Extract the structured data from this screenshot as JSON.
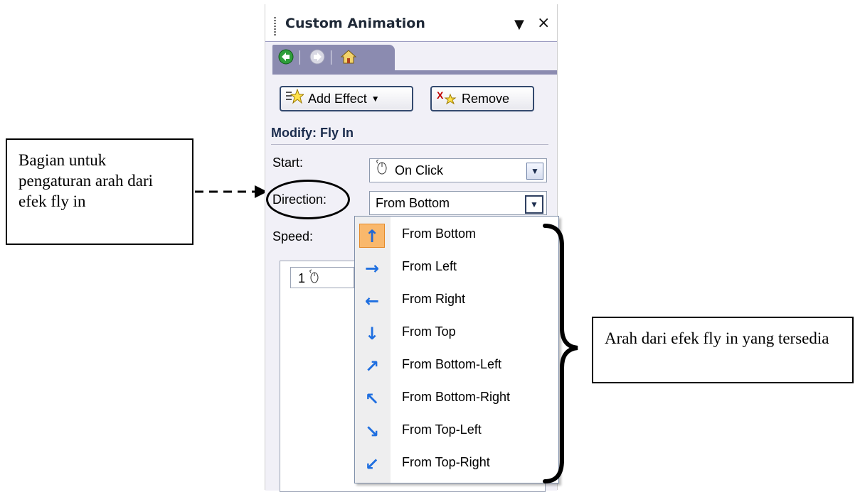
{
  "pane": {
    "title": "Custom Animation",
    "dropdown_glyph": "▼",
    "close_glyph": "×",
    "nav": {
      "back_icon": "back-arrow-icon",
      "forward_icon": "forward-arrow-icon",
      "home_icon": "home-icon"
    },
    "add_effect_label": "Add Effect",
    "remove_label": "Remove",
    "modify_label": "Modify: Fly In",
    "start_label": "Start:",
    "start_value": "On Click",
    "direction_label": "Direction:",
    "direction_value": "From Bottom",
    "speed_label": "Speed:",
    "list_entry": "1"
  },
  "menu": {
    "items": [
      {
        "label": "From Bottom",
        "icon": "arrow-up-icon",
        "glyph": "↑",
        "selected": true
      },
      {
        "label": "From Left",
        "icon": "arrow-right-icon",
        "glyph": "→"
      },
      {
        "label": "From Right",
        "icon": "arrow-left-icon",
        "glyph": "←"
      },
      {
        "label": "From Top",
        "icon": "arrow-down-icon",
        "glyph": "↓"
      },
      {
        "label": "From Bottom-Left",
        "icon": "arrow-up-right-icon",
        "glyph": "↗"
      },
      {
        "label": "From Bottom-Right",
        "icon": "arrow-up-left-icon",
        "glyph": "↖"
      },
      {
        "label": "From Top-Left",
        "icon": "arrow-down-right-icon",
        "glyph": "↘"
      },
      {
        "label": "From Top-Right",
        "icon": "arrow-down-left-icon",
        "glyph": "↙"
      }
    ]
  },
  "callouts": {
    "left": "Bagian untuk pengaturan arah dari efek fly in",
    "right": "Arah dari efek fly in yang tersedia"
  },
  "colors": {
    "accent_orange": "#f9b86c",
    "arrow_blue": "#1f6fe0",
    "pane_header": "#8b8bb0"
  }
}
